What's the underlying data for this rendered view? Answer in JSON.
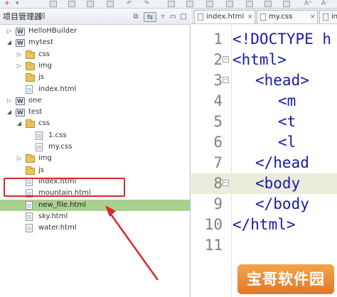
{
  "explorer": {
    "title": "项目管理器",
    "close_glyph": "☒"
  },
  "tree": [
    {
      "type": "project",
      "label": "HelloHBuilder",
      "expanded": false,
      "depth": 0
    },
    {
      "type": "project",
      "label": "mytest",
      "expanded": true,
      "depth": 0
    },
    {
      "type": "folder",
      "label": "css",
      "expanded": false,
      "depth": 1
    },
    {
      "type": "folder",
      "label": "img",
      "expanded": false,
      "depth": 1
    },
    {
      "type": "folder",
      "label": "js",
      "expanded": null,
      "depth": 1
    },
    {
      "type": "file",
      "label": "index.html",
      "depth": 1
    },
    {
      "type": "project",
      "label": "one",
      "expanded": false,
      "depth": 0
    },
    {
      "type": "project",
      "label": "test",
      "expanded": true,
      "depth": 0
    },
    {
      "type": "folder",
      "label": "css",
      "expanded": true,
      "depth": 1
    },
    {
      "type": "css",
      "label": "1.css",
      "depth": 2
    },
    {
      "type": "css",
      "label": "my.css",
      "depth": 2
    },
    {
      "type": "folder",
      "label": "img",
      "expanded": false,
      "depth": 1
    },
    {
      "type": "folder",
      "label": "js",
      "expanded": null,
      "depth": 1
    },
    {
      "type": "file",
      "label": "index.html",
      "depth": 1
    },
    {
      "type": "file",
      "label": "mountain.html",
      "depth": 1
    },
    {
      "type": "file",
      "label": "new_file.html",
      "depth": 1,
      "selected": true
    },
    {
      "type": "file",
      "label": "sky.html",
      "depth": 1
    },
    {
      "type": "file",
      "label": "water.html",
      "depth": 1
    }
  ],
  "editor": {
    "tabs": [
      {
        "label": "index.html",
        "active": true
      },
      {
        "label": "my.css",
        "active": false
      },
      {
        "label": "inde",
        "active": false
      }
    ],
    "current_line": 8,
    "lines": [
      {
        "num": "1",
        "text": "<!DOCTYPE h",
        "indent": 0,
        "fold": false
      },
      {
        "num": "2",
        "text": "<html>",
        "indent": 0,
        "fold": true
      },
      {
        "num": "3",
        "text": "<head>",
        "indent": 1,
        "fold": true
      },
      {
        "num": "4",
        "text": "<m",
        "indent": 2,
        "fold": false
      },
      {
        "num": "5",
        "text": "<t",
        "indent": 2,
        "fold": false
      },
      {
        "num": "6",
        "text": "<l",
        "indent": 2,
        "fold": false
      },
      {
        "num": "7",
        "text": "</head",
        "indent": 1,
        "fold": false
      },
      {
        "num": "8",
        "text": "<body",
        "indent": 1,
        "fold": true
      },
      {
        "num": "9",
        "text": "</body",
        "indent": 1,
        "fold": false
      },
      {
        "num": "10",
        "text": "</html>",
        "indent": 0,
        "fold": false
      },
      {
        "num": "11",
        "text": "",
        "indent": 0,
        "fold": false
      }
    ]
  },
  "watermark": {
    "text": "宝哥软件园"
  },
  "colors": {
    "selection": "#a9d18e",
    "highlight_box": "#d42a2a",
    "current_line": "#e8eedb",
    "code_text": "#1a1aa6"
  }
}
